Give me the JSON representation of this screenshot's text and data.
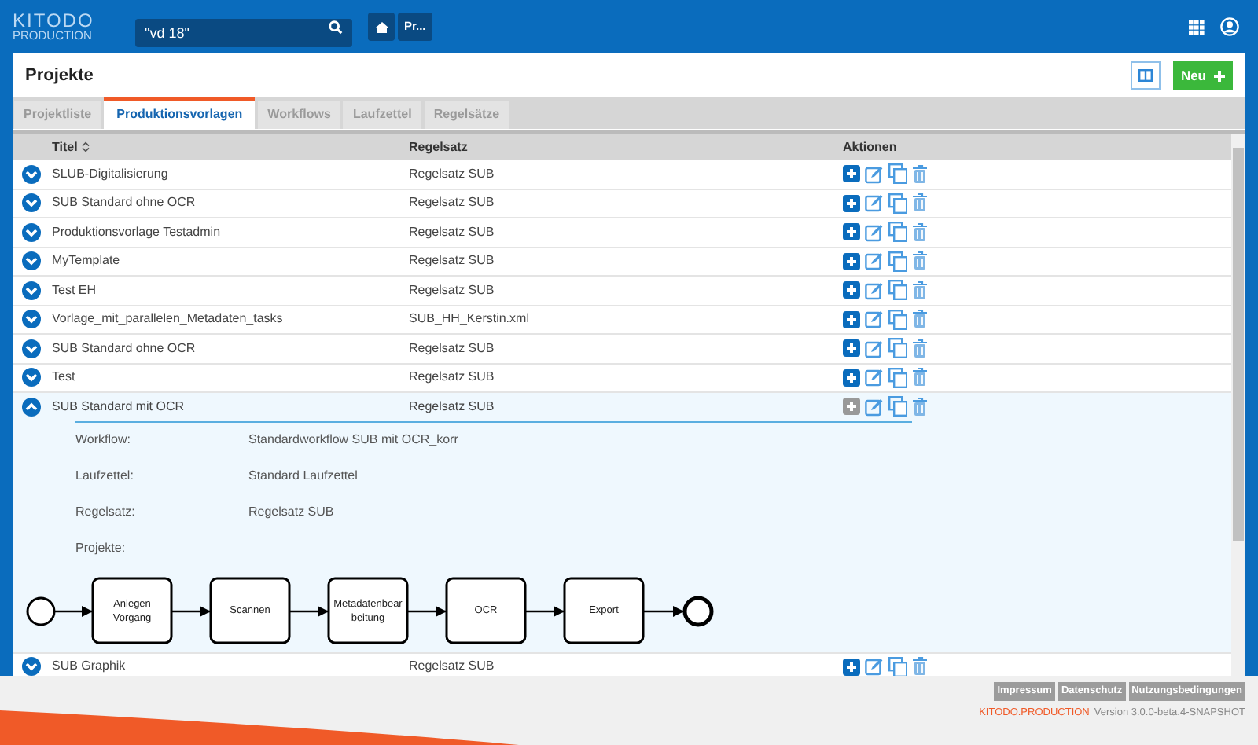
{
  "header": {
    "logo_top": "KITODO",
    "logo_bottom": "PRODUCTION",
    "search": {
      "value": "\"vd 18\""
    },
    "breadcrumb": "Pr..."
  },
  "page": {
    "title": "Projekte",
    "new_button": "Neu"
  },
  "tabs": [
    {
      "label": "Projektliste",
      "selected": false
    },
    {
      "label": "Produktionsvorlagen",
      "selected": true
    },
    {
      "label": "Workflows",
      "selected": false
    },
    {
      "label": "Laufzettel",
      "selected": false
    },
    {
      "label": "Regelsätze",
      "selected": false
    }
  ],
  "table": {
    "columns": [
      "Titel",
      "Regelsatz",
      "Aktionen"
    ],
    "rows": [
      {
        "title": "SLUB-Digitalisierung",
        "ruleset": "Regelsatz SUB",
        "expanded": false
      },
      {
        "title": "SUB Standard ohne OCR",
        "ruleset": "Regelsatz SUB",
        "expanded": false
      },
      {
        "title": "Produktionsvorlage Testadmin",
        "ruleset": "Regelsatz SUB",
        "expanded": false
      },
      {
        "title": "MyTemplate",
        "ruleset": "Regelsatz SUB",
        "expanded": false
      },
      {
        "title": "Test EH",
        "ruleset": "Regelsatz SUB",
        "expanded": false
      },
      {
        "title": "Vorlage_mit_parallelen_Metadaten_tasks",
        "ruleset": "SUB_HH_Kerstin.xml",
        "expanded": false
      },
      {
        "title": "SUB Standard ohne OCR",
        "ruleset": "Regelsatz SUB",
        "expanded": false
      },
      {
        "title": "Test",
        "ruleset": "Regelsatz SUB",
        "expanded": false
      },
      {
        "title": "SUB Standard mit OCR",
        "ruleset": "Regelsatz SUB",
        "expanded": true,
        "details": {
          "fields": [
            {
              "label": "Workflow:",
              "value": "Standardworkflow SUB mit OCR_korr"
            },
            {
              "label": "Laufzettel:",
              "value": "Standard Laufzettel"
            },
            {
              "label": "Regelsatz:",
              "value": "Regelsatz SUB"
            },
            {
              "label": "Projekte:"
            }
          ],
          "workflow_steps": [
            "Anlegen Vorgang",
            "Scannen",
            "Metadatenbear beitung",
            "OCR",
            "Export"
          ]
        }
      },
      {
        "title": "SUB Graphik",
        "ruleset": "Regelsatz SUB",
        "expanded": false
      }
    ]
  },
  "footer": {
    "links": [
      "Impressum",
      "Datenschutz",
      "Nutzungsbedingungen"
    ],
    "brand": "KITODO.PRODUCTION",
    "version": "Version 3.0.0-beta.4-SNAPSHOT"
  }
}
